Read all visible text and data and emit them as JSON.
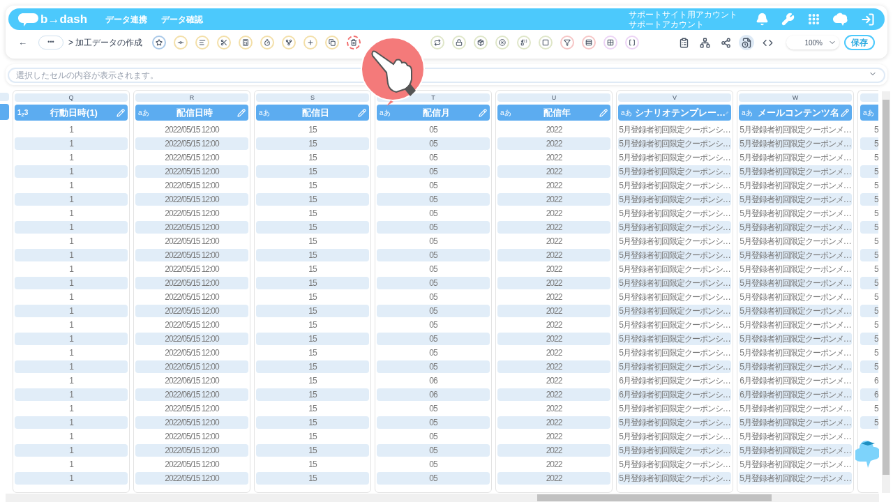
{
  "header": {
    "logo": "b→dash",
    "nav": [
      "データ連携",
      "データ確認"
    ],
    "account": [
      "サポートサイト用アカウント",
      "サポートアカウント"
    ]
  },
  "toolbar": {
    "back": "←",
    "more": "•••",
    "breadcrumb": "> 加工データの作成",
    "tools": [
      {
        "kind": "star",
        "color": "#a9c8e8",
        "highlighted": false
      },
      {
        "kind": "connect",
        "color": "#f3dfa8",
        "highlighted": false
      },
      {
        "kind": "text",
        "color": "#f3dfa8",
        "highlighted": false
      },
      {
        "kind": "scissors",
        "color": "#f3dfa8",
        "highlighted": false
      },
      {
        "kind": "calc",
        "color": "#f3dfa8",
        "highlighted": false
      },
      {
        "kind": "timer",
        "color": "#f3dfa8",
        "highlighted": false
      },
      {
        "kind": "branch",
        "color": "#f3dfa8",
        "highlighted": false
      },
      {
        "kind": "plus",
        "color": "#f3dfa8",
        "highlighted": false
      },
      {
        "kind": "copy",
        "color": "#f3dfa8",
        "highlighted": false
      },
      {
        "kind": "trash",
        "color": "#f26b6b",
        "highlighted": true
      },
      {
        "kind": "repeat",
        "color": "#dfe6c8",
        "highlighted": false
      },
      {
        "kind": "lock",
        "color": "#dfe6c8",
        "highlighted": false
      },
      {
        "kind": "box",
        "color": "#dfe6c8",
        "highlighted": false
      },
      {
        "kind": "cancel",
        "color": "#dfe6c8",
        "highlighted": false
      },
      {
        "kind": "swap",
        "color": "#dfe6c8",
        "highlighted": false
      },
      {
        "kind": "square",
        "color": "#dfe6c8",
        "highlighted": false
      },
      {
        "kind": "filter",
        "color": "#f6c5c5",
        "highlighted": false
      },
      {
        "kind": "split",
        "color": "#f6c5c5",
        "highlighted": false
      },
      {
        "kind": "grid",
        "color": "#ecd3f5",
        "highlighted": false
      },
      {
        "kind": "brackets",
        "color": "#ecd3f5",
        "highlighted": false
      }
    ],
    "right_tools": [
      {
        "kind": "clipboard",
        "selected": false
      },
      {
        "kind": "network",
        "selected": false
      },
      {
        "kind": "share",
        "selected": false
      },
      {
        "kind": "file-refresh",
        "selected": true
      },
      {
        "kind": "code",
        "selected": false
      }
    ],
    "zoom": "100%",
    "save": "保存"
  },
  "formula_bar": {
    "placeholder": "選択したセルの内容が表示されます。"
  },
  "columns": [
    {
      "letter": "Q",
      "kind": "number",
      "type_label": "1$_{2}$3",
      "title": "行動日時(1)",
      "cells": [
        "1",
        "1",
        "1",
        "1",
        "1",
        "1",
        "1",
        "1",
        "1",
        "1",
        "1",
        "1",
        "1",
        "1",
        "1",
        "1",
        "1",
        "1",
        "1",
        "1",
        "1",
        "1",
        "1",
        "1",
        "1",
        "1"
      ]
    },
    {
      "letter": "R",
      "kind": "text",
      "type_label": "aあ",
      "title": "配信日時",
      "cells": [
        "2022/05/15 12:00",
        "2022/05/15 12:00",
        "2022/05/15 12:00",
        "2022/05/15 12:00",
        "2022/05/15 12:00",
        "2022/05/15 12:00",
        "2022/05/15 12:00",
        "2022/05/15 12:00",
        "2022/05/15 12:00",
        "2022/05/15 12:00",
        "2022/05/15 12:00",
        "2022/05/15 12:00",
        "2022/05/15 12:00",
        "2022/05/15 12:00",
        "2022/05/15 12:00",
        "2022/05/15 12:00",
        "2022/05/15 12:00",
        "2022/05/15 12:00",
        "2022/06/15 12:00",
        "2022/06/15 12:00",
        "2022/05/15 12:00",
        "2022/05/15 12:00",
        "2022/05/15 12:00",
        "2022/05/15 12:00",
        "2022/05/15 12:00",
        "2022/05/15 12:00"
      ]
    },
    {
      "letter": "S",
      "kind": "text",
      "type_label": "aあ",
      "title": "配信日",
      "cells": [
        "15",
        "15",
        "15",
        "15",
        "15",
        "15",
        "15",
        "15",
        "15",
        "15",
        "15",
        "15",
        "15",
        "15",
        "15",
        "15",
        "15",
        "15",
        "15",
        "15",
        "15",
        "15",
        "15",
        "15",
        "15",
        "15"
      ]
    },
    {
      "letter": "T",
      "kind": "text",
      "type_label": "aあ",
      "title": "配信月",
      "cells": [
        "05",
        "05",
        "05",
        "05",
        "05",
        "05",
        "05",
        "05",
        "05",
        "05",
        "05",
        "05",
        "05",
        "05",
        "05",
        "05",
        "05",
        "05",
        "06",
        "06",
        "05",
        "05",
        "05",
        "05",
        "05",
        "05"
      ]
    },
    {
      "letter": "U",
      "kind": "text",
      "type_label": "aあ",
      "title": "配信年",
      "cells": [
        "2022",
        "2022",
        "2022",
        "2022",
        "2022",
        "2022",
        "2022",
        "2022",
        "2022",
        "2022",
        "2022",
        "2022",
        "2022",
        "2022",
        "2022",
        "2022",
        "2022",
        "2022",
        "2022",
        "2022",
        "2022",
        "2022",
        "2022",
        "2022",
        "2022",
        "2022"
      ]
    },
    {
      "letter": "V",
      "kind": "text",
      "type_label": "aあ",
      "title": "シナリオテンプレー…",
      "cells": [
        "5月登録者初回限定クーポンシ…",
        "5月登録者初回限定クーポンシ…",
        "5月登録者初回限定クーポンシ…",
        "5月登録者初回限定クーポンシ…",
        "5月登録者初回限定クーポンシ…",
        "5月登録者初回限定クーポンシ…",
        "5月登録者初回限定クーポンシ…",
        "5月登録者初回限定クーポンシ…",
        "5月登録者初回限定クーポンシ…",
        "5月登録者初回限定クーポンシ…",
        "5月登録者初回限定クーポンシ…",
        "5月登録者初回限定クーポンシ…",
        "5月登録者初回限定クーポンシ…",
        "5月登録者初回限定クーポンシ…",
        "5月登録者初回限定クーポンシ…",
        "5月登録者初回限定クーポンシ…",
        "5月登録者初回限定クーポンシ…",
        "5月登録者初回限定クーポンシ…",
        "6月登録者初回限定クーポンシ…",
        "6月登録者初回限定クーポンシ…",
        "5月登録者初回限定クーポンシ…",
        "5月登録者初回限定クーポンシ…",
        "5月登録者初回限定クーポンシ…",
        "5月登録者初回限定クーポンシ…",
        "5月登録者初回限定クーポンシ…",
        "5月登録者初回限定クーポンシ…"
      ]
    },
    {
      "letter": "W",
      "kind": "text",
      "type_label": "aあ",
      "title": "メールコンテンツ名",
      "cells": [
        "5月登録者初回限定クーポンメ…",
        "5月登録者初回限定クーポンメ…",
        "5月登録者初回限定クーポンメ…",
        "5月登録者初回限定クーポンメ…",
        "5月登録者初回限定クーポンメ…",
        "5月登録者初回限定クーポンメ…",
        "5月登録者初回限定クーポンメ…",
        "5月登録者初回限定クーポンメ…",
        "5月登録者初回限定クーポンメ…",
        "5月登録者初回限定クーポンメ…",
        "5月登録者初回限定クーポンメ…",
        "5月登録者初回限定クーポンメ…",
        "5月登録者初回限定クーポンメ…",
        "5月登録者初回限定クーポンメ…",
        "5月登録者初回限定クーポンメ…",
        "5月登録者初回限定クーポンメ…",
        "5月登録者初回限定クーポンメ…",
        "5月登録者初回限定クーポンメ…",
        "6月登録者初回限定クーポンメ…",
        "6月登録者初回限定クーポンメ…",
        "5月登録者初回限定クーポンメ…",
        "5月登録者初回限定クーポンメ…",
        "5月登録者初回限定クーポンメ…",
        "5月登録者初回限定クーポンメ…",
        "5月登録者初回限定クーポンメ…",
        "5月登録者初回限定クーポンメ…"
      ]
    },
    {
      "kind": "text",
      "type_label": "aあ",
      "cells": [
        "5",
        "5",
        "5",
        "5",
        "5",
        "5",
        "5",
        "5",
        "5",
        "5",
        "5",
        "5",
        "5",
        "5",
        "5",
        "5",
        "5",
        "5",
        "6",
        "6",
        "5",
        "5"
      ]
    }
  ]
}
